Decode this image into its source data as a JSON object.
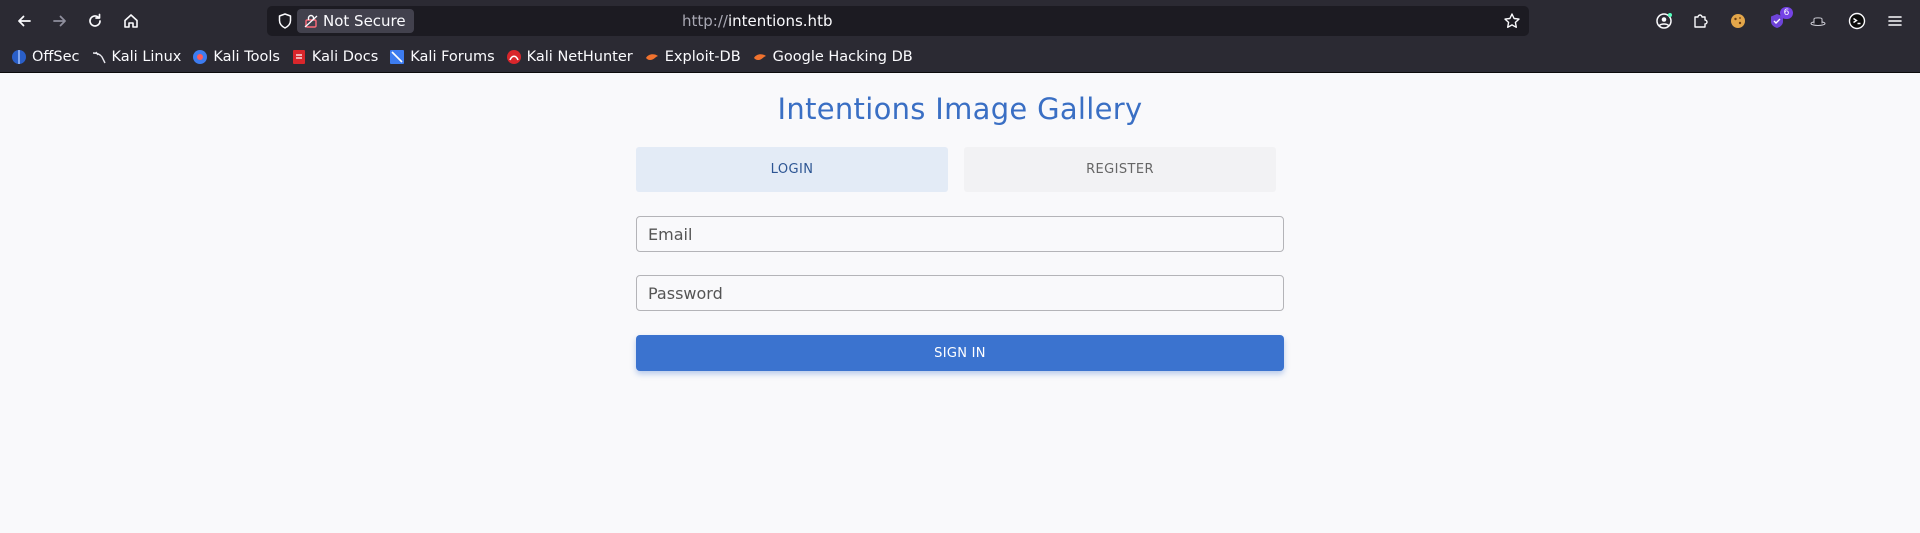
{
  "browser": {
    "security_label": "Not Secure",
    "url_protocol": "http://",
    "url_host": "intentions.htb",
    "extension_badge": "6"
  },
  "bookmarks": [
    {
      "label": "OffSec",
      "icon": "offsec-icon"
    },
    {
      "label": "Kali Linux",
      "icon": "kali-dragon-icon"
    },
    {
      "label": "Kali Tools",
      "icon": "kali-tools-icon"
    },
    {
      "label": "Kali Docs",
      "icon": "kali-docs-icon"
    },
    {
      "label": "Kali Forums",
      "icon": "kali-forums-icon"
    },
    {
      "label": "Kali NetHunter",
      "icon": "kali-nethunter-icon"
    },
    {
      "label": "Exploit-DB",
      "icon": "exploit-db-icon"
    },
    {
      "label": "Google Hacking DB",
      "icon": "ghdb-icon"
    }
  ],
  "page": {
    "title": "Intentions Image Gallery",
    "tabs": [
      {
        "label": "LOGIN",
        "active": true
      },
      {
        "label": "REGISTER",
        "active": false
      }
    ],
    "email_placeholder": "Email",
    "password_placeholder": "Password",
    "signin_label": "SIGN IN"
  },
  "colors": {
    "accent": "#3b73cf",
    "title": "#3a6fc4",
    "chrome": "#2b2a33"
  }
}
